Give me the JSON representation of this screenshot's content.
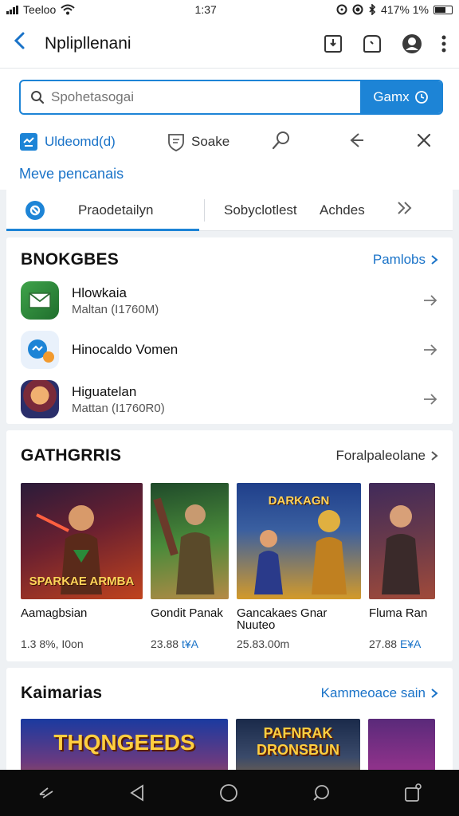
{
  "status": {
    "carrier": "Teeloo",
    "time": "1:37",
    "battery_text": "417% 1%"
  },
  "app_bar": {
    "title": "Nplipllenani"
  },
  "search": {
    "placeholder": "Spohetasogai",
    "button_label": "Gamx"
  },
  "quick": {
    "primary_label": "Uldeomd(d)",
    "secondary_label": "Soake"
  },
  "manage_link": "Meve pencanais",
  "tabs": [
    {
      "label": "Praodetailyn"
    },
    {
      "label": "Sobyclotlest"
    },
    {
      "label": "Achdes"
    }
  ],
  "bookings": {
    "title": "BNOKGBES",
    "link": "Pamlobs",
    "items": [
      {
        "name": "Hlowkaia",
        "sub": "Maltan (I1760M)"
      },
      {
        "name": "Hinocaldo Vomen",
        "sub": ""
      },
      {
        "name": "Higuatelan",
        "sub": "Mattan (I1760R0)"
      }
    ]
  },
  "games": {
    "title": "GATHGRRIS",
    "link": "Foralpaleolane",
    "items": [
      {
        "name": "Aamagbsian",
        "meta_plain": "1.3 8%, I0on",
        "meta_hl": "",
        "art_label": "SPARKAE ARMBA",
        "color_a": "#2a1b3a",
        "color_b": "#c0431d"
      },
      {
        "name": "Gondit Panak",
        "meta_plain": "23.88 ",
        "meta_hl": "t¥A",
        "art_label": "",
        "color_a": "#2a5a2a",
        "color_b": "#b58a46"
      },
      {
        "name": "Gancakaes Gnar Nuuteo",
        "meta_plain": "25.83.00m",
        "meta_hl": "",
        "art_label": "DARKAGN",
        "color_a": "#1f3f8a",
        "color_b": "#d39a2a"
      },
      {
        "name": "Fluma Ran",
        "meta_plain": "27.88 ",
        "meta_hl": "E¥A",
        "art_label": "",
        "color_a": "#402a5a",
        "color_b": "#a04a3a"
      }
    ]
  },
  "kaimarias": {
    "title": "Kaimarias",
    "link": "Kammeoace sain",
    "items": [
      {
        "art_label": "THQNGEEDS",
        "color_a": "#1a3aa0",
        "color_b": "#e06a1a"
      },
      {
        "art_label": "PAFNRAK DRONSBUN",
        "color_a": "#1a2a4a",
        "color_b": "#d48a20"
      },
      {
        "art_label": "",
        "color_a": "#5a2a7a",
        "color_b": "#c03a9a"
      }
    ]
  },
  "colors": {
    "accent": "#1d84d6",
    "link": "#1a73c8"
  }
}
